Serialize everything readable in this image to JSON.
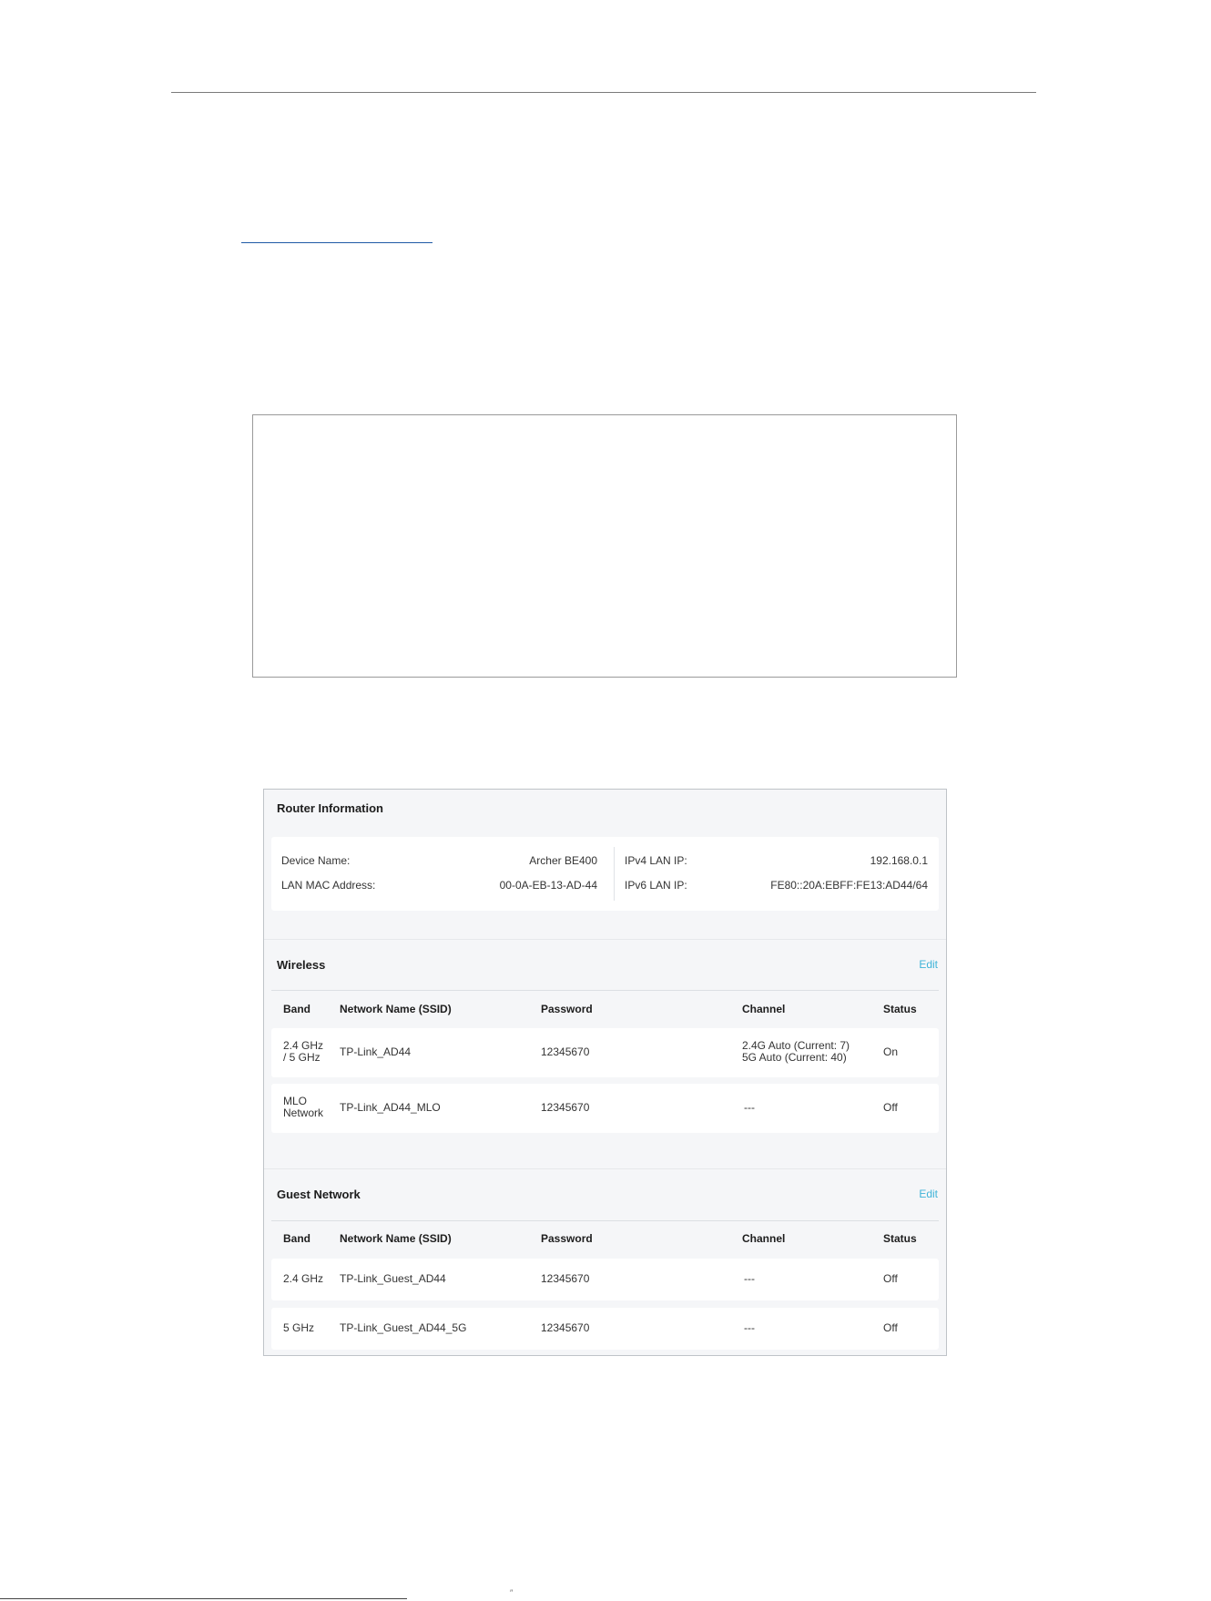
{
  "router_info": {
    "title": "Router Information",
    "device_name_label": "Device Name:",
    "device_name_value": "Archer BE400",
    "lan_mac_label": "LAN MAC Address:",
    "lan_mac_value": "00-0A-EB-13-AD-44",
    "ipv4_label": "IPv4 LAN IP:",
    "ipv4_value": "192.168.0.1",
    "ipv6_label": "IPv6 LAN IP:",
    "ipv6_value": "FE80::20A:EBFF:FE13:AD44/64"
  },
  "wireless": {
    "title": "Wireless",
    "edit_label": "Edit",
    "columns": [
      "Band",
      "Network Name (SSID)",
      "Password",
      "Channel",
      "Status"
    ],
    "rows": [
      {
        "band": [
          "2.4 GHz",
          "/ 5 GHz"
        ],
        "ssid": "TP-Link_AD44",
        "password": "12345670",
        "channel": [
          "2.4G Auto (Current: 7)",
          "5G Auto (Current: 40)"
        ],
        "status": "On"
      },
      {
        "band": [
          "MLO",
          "Network"
        ],
        "ssid": "TP-Link_AD44_MLO",
        "password": "12345670",
        "channel": [
          "---"
        ],
        "status": "Off"
      }
    ]
  },
  "guest": {
    "title": "Guest Network",
    "edit_label": "Edit",
    "columns": [
      "Band",
      "Network Name (SSID)",
      "Password",
      "Channel",
      "Status"
    ],
    "rows": [
      {
        "band": [
          "2.4 GHz"
        ],
        "ssid": "TP-Link_Guest_AD44",
        "password": "12345670",
        "channel": [
          "---"
        ],
        "status": "Off"
      },
      {
        "band": [
          "5 GHz"
        ],
        "ssid": "TP-Link_Guest_AD44_5G",
        "password": "12345670",
        "channel": [
          "---"
        ],
        "status": "Off"
      }
    ]
  }
}
